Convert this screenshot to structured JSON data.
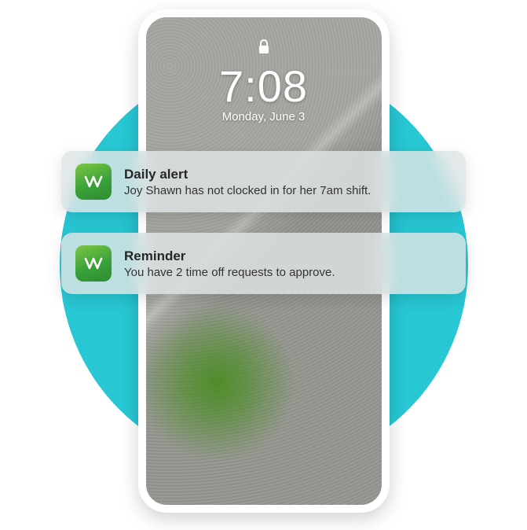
{
  "lockscreen": {
    "time": "7:08",
    "date": "Monday, June 3"
  },
  "notifications": [
    {
      "title": "Daily alert",
      "body": "Joy Shawn has not clocked in for her 7am shift."
    },
    {
      "title": "Reminder",
      "body": "You have 2 time off requests to approve."
    }
  ]
}
